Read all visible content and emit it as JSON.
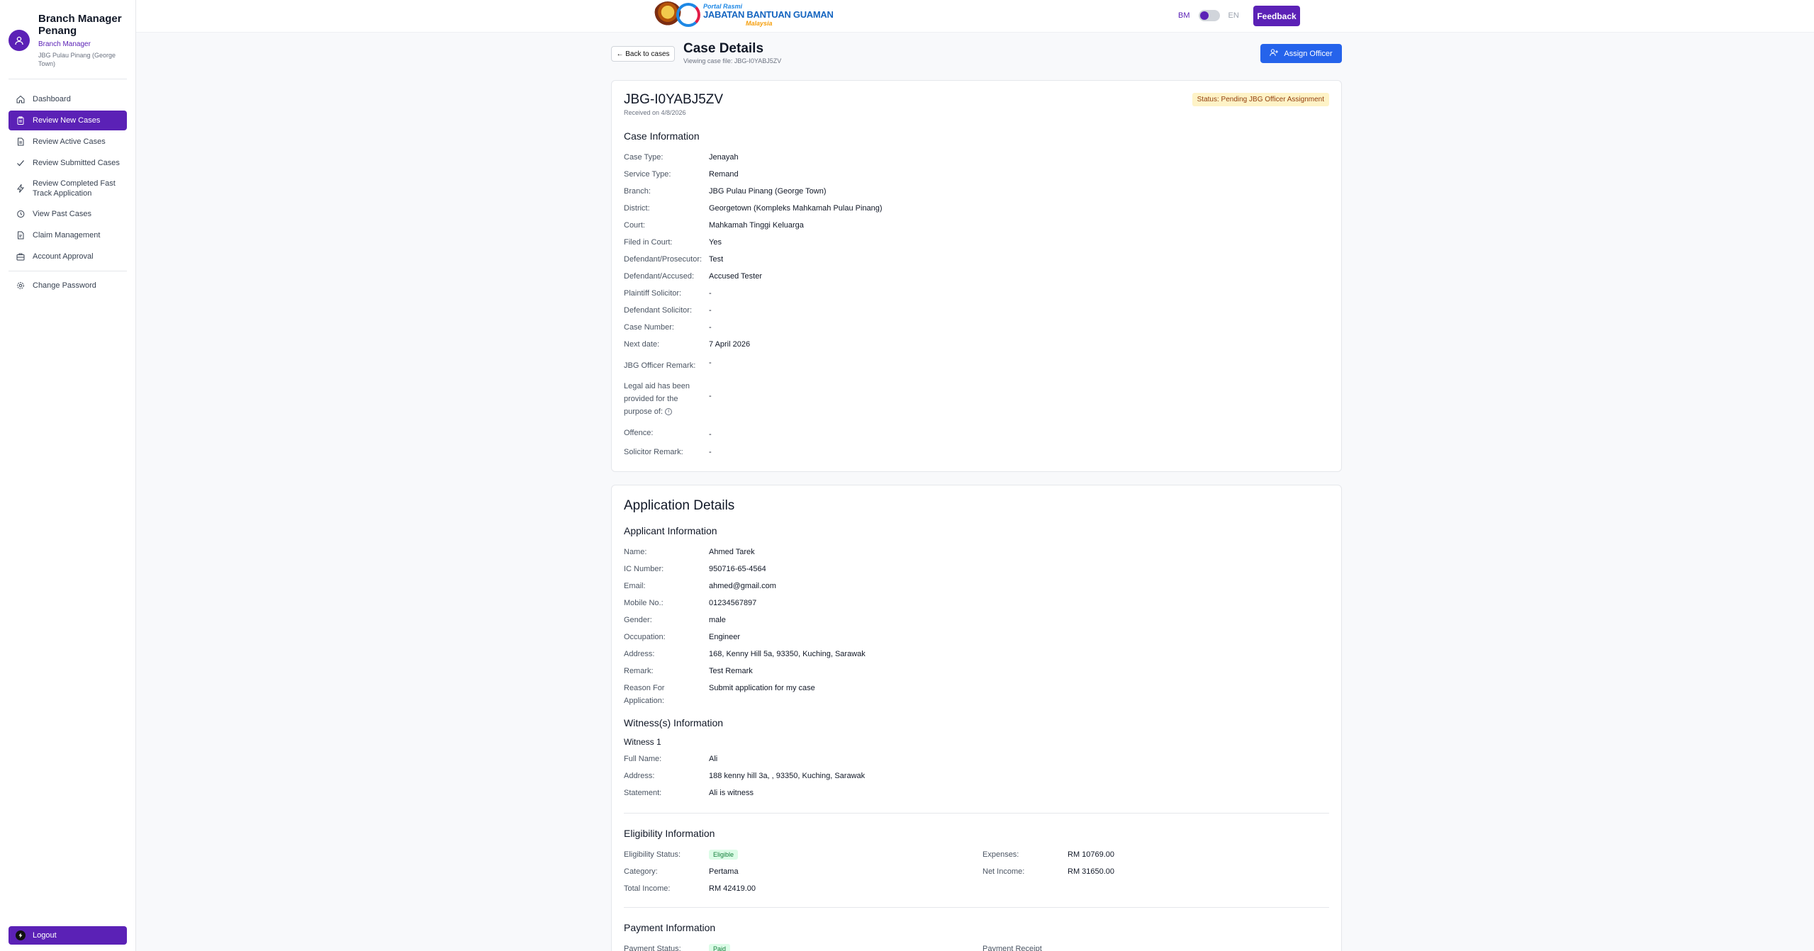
{
  "user": {
    "name": "Branch Manager Penang",
    "role": "Branch Manager",
    "branch": "JBG Pulau Pinang (George Town)"
  },
  "nav": {
    "items": [
      {
        "label": "Dashboard",
        "icon": "home-icon"
      },
      {
        "label": "Review New Cases",
        "icon": "clipboard-icon"
      },
      {
        "label": "Review Active Cases",
        "icon": "file-icon"
      },
      {
        "label": "Review Submitted Cases",
        "icon": "check-icon"
      },
      {
        "label": "Review Completed Fast Track Application",
        "icon": "bolt-icon"
      },
      {
        "label": "View Past Cases",
        "icon": "history-icon"
      },
      {
        "label": "Claim Management",
        "icon": "document-icon"
      },
      {
        "label": "Account Approval",
        "icon": "briefcase-icon"
      },
      {
        "label": "Change Password",
        "icon": "gear-icon"
      }
    ],
    "logout": "Logout"
  },
  "header": {
    "logo": {
      "top": "Portal Rasmi",
      "main": "JABATAN BANTUAN GUAMAN",
      "bottom": "Malaysia"
    },
    "lang_bm": "BM",
    "lang_en": "EN",
    "feedback": "Feedback"
  },
  "page": {
    "back": "← Back to cases",
    "title": "Case Details",
    "subtitle": "Viewing case file: JBG-I0YABJ5ZV",
    "assign": "Assign Officer"
  },
  "case": {
    "id": "JBG-I0YABJ5ZV",
    "received": "Received on 4/8/2026",
    "status": "Status: Pending JBG Officer Assignment",
    "section_title": "Case Information",
    "fields": [
      {
        "label": "Case Type:",
        "value": "Jenayah"
      },
      {
        "label": "Service Type:",
        "value": "Remand"
      },
      {
        "label": "Branch:",
        "value": "JBG Pulau Pinang (George Town)"
      },
      {
        "label": "District:",
        "value": "Georgetown (Kompleks Mahkamah Pulau Pinang)"
      },
      {
        "label": "Court:",
        "value": "Mahkamah Tinggi Keluarga"
      },
      {
        "label": "Filed in Court:",
        "value": "Yes"
      },
      {
        "label": "Defendant/Prosecutor:",
        "value": "Test"
      },
      {
        "label": "Defendant/Accused:",
        "value": "Accused Tester"
      },
      {
        "label": "Plaintiff Solicitor:",
        "value": "-"
      },
      {
        "label": "Defendant Solicitor:",
        "value": "-"
      },
      {
        "label": "Case Number:",
        "value": "-"
      },
      {
        "label": "Next date:",
        "value": "7 April 2026"
      }
    ],
    "officer_remark_label": "JBG Officer Remark:",
    "officer_remark_value": "-",
    "legal_aid_label": "Legal aid has been provided for the purpose of:",
    "legal_aid_value": "-",
    "offence_label": "Offence:",
    "offence_value": "-",
    "solicitor_remark_label": "Solicitor Remark:",
    "solicitor_remark_value": "-"
  },
  "application": {
    "title": "Application Details",
    "applicant_title": "Applicant Information",
    "applicant": [
      {
        "label": "Name:",
        "value": "Ahmed Tarek"
      },
      {
        "label": "IC Number:",
        "value": "950716-65-4564"
      },
      {
        "label": "Email:",
        "value": "ahmed@gmail.com"
      },
      {
        "label": "Mobile No.:",
        "value": "01234567897"
      },
      {
        "label": "Gender:",
        "value": "male"
      },
      {
        "label": "Occupation:",
        "value": "Engineer"
      },
      {
        "label": "Address:",
        "value": "168, Kenny Hill 5a, 93350, Kuching, Sarawak"
      },
      {
        "label": "Remark:",
        "value": "Test Remark"
      }
    ],
    "reason_label": "Reason For Application:",
    "reason_value": "Submit application for my case",
    "witness_title": "Witness(s) Information",
    "witness_heading": "Witness 1",
    "witness": [
      {
        "label": "Full Name:",
        "value": "Ali"
      },
      {
        "label": "Address:",
        "value": "188 kenny hill 3a, , 93350, Kuching, Sarawak"
      },
      {
        "label": "Statement:",
        "value": "Ali is witness"
      }
    ],
    "eligibility_title": "Eligibility Information",
    "eligibility_status_label": "Eligibility Status:",
    "eligibility_status_value": "Eligible",
    "category_label": "Category:",
    "category_value": "Pertama",
    "total_income_label": "Total Income:",
    "total_income_value": "RM 42419.00",
    "expenses_label": "Expenses:",
    "expenses_value": "RM 10769.00",
    "net_income_label": "Net Income:",
    "net_income_value": "RM 31650.00",
    "payment_title": "Payment Information",
    "payment_status_label": "Payment Status:",
    "payment_status_value": "Paid",
    "payment_receipt_label": "Payment Receipt"
  }
}
